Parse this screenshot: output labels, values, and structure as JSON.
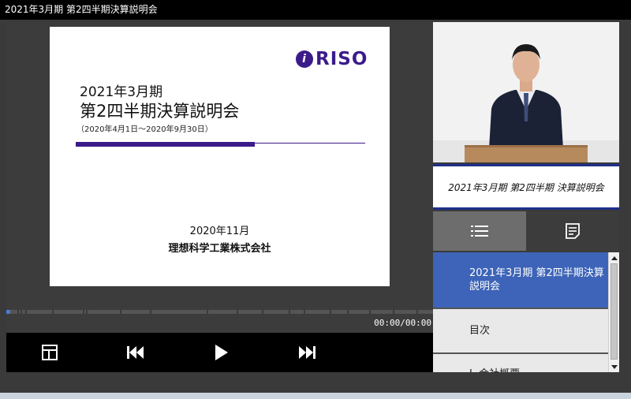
{
  "window": {
    "title": "2021年3月期 第2四半期決算説明会"
  },
  "slide": {
    "logo_text": "RISO",
    "line1": "2021年3月期",
    "line2": "第2四半期決算説明会",
    "range": "（2020年4月1日～2020年9月30日）",
    "date": "2020年11月",
    "company": "理想科学工業株式会社",
    "brand_color": "#3b1b8a"
  },
  "player": {
    "timecode": "00:00/00:00",
    "progress_fraction": 0.01,
    "controls": {
      "layout": "layout-icon",
      "prev": "skip-previous-icon",
      "play": "play-icon",
      "next": "skip-next-icon"
    }
  },
  "presenter": {
    "caption": "2021年3月期 第2四半期 決算説明会"
  },
  "panel": {
    "tabs": [
      {
        "icon": "list-icon",
        "active": true
      },
      {
        "icon": "notes-icon",
        "active": false
      }
    ],
    "toc": [
      {
        "label": "2021年3月期 第2四半期決算説明会",
        "active": true
      },
      {
        "label": "目次",
        "active": false
      },
      {
        "label": "Ⅰ. 会社概要",
        "active": false
      }
    ]
  },
  "colors": {
    "accent": "#3d64b8",
    "caption_border": "#1f2f8a"
  }
}
